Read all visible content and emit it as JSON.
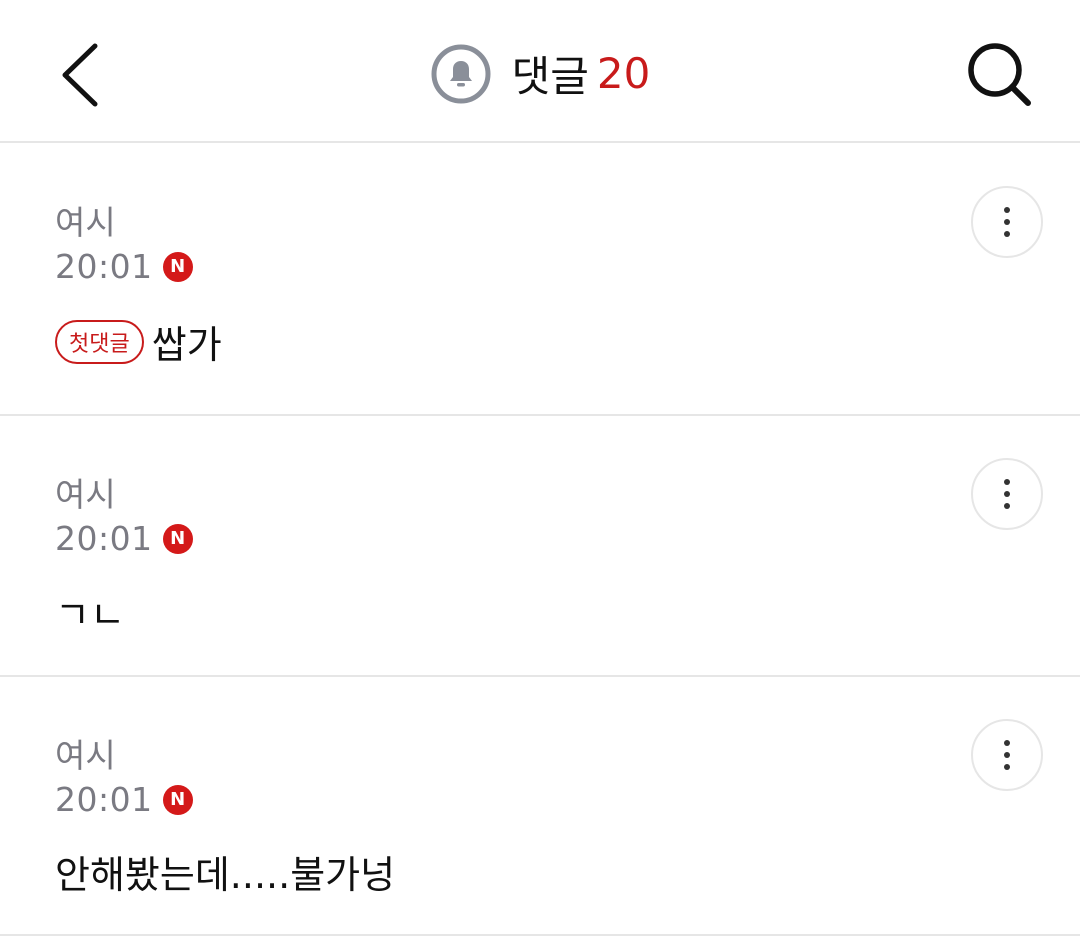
{
  "header": {
    "title": "댓글",
    "count": "20",
    "accent_color": "#c81b1b",
    "icons": {
      "back": "back-arrow-icon",
      "bell": "bell-icon",
      "search": "search-icon"
    }
  },
  "comments": [
    {
      "author": "여시",
      "time": "20:01",
      "new_badge": "N",
      "tag": "첫댓글",
      "text": "쌉가"
    },
    {
      "author": "여시",
      "time": "20:01",
      "new_badge": "N",
      "tag": "",
      "text": "ㄱㄴ"
    },
    {
      "author": "여시",
      "time": "20:01",
      "new_badge": "N",
      "tag": "",
      "text": "안해봤는데.....불가넝"
    }
  ]
}
